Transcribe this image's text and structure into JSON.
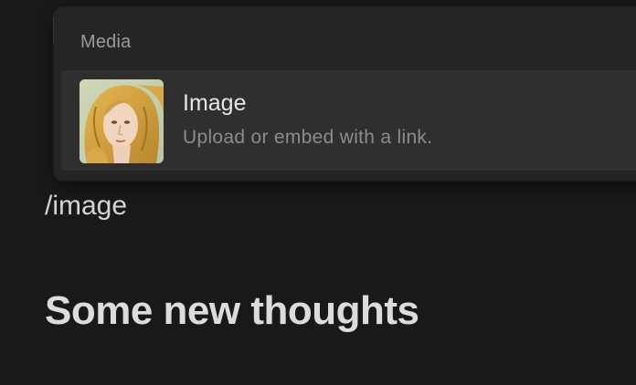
{
  "menu": {
    "section_title": "Media",
    "item": {
      "title": "Image",
      "description": "Upload or embed with a link.",
      "thumbnail_icon": "image-thumbnail"
    }
  },
  "editor": {
    "slash_command": "/image",
    "heading": "Some new thoughts"
  },
  "colors": {
    "background": "#191919",
    "menu_background": "#252525",
    "item_highlight": "#2f2f2f"
  }
}
